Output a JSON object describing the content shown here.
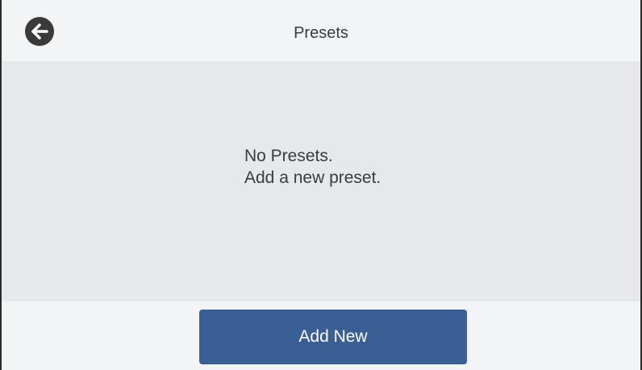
{
  "header": {
    "title": "Presets",
    "back_icon": "arrow-left-icon"
  },
  "content": {
    "message_line1": "No Presets.",
    "message_line2": "Add a new preset."
  },
  "footer": {
    "add_new_label": "Add New"
  },
  "colors": {
    "header_bg": "#f3f4f6",
    "content_bg": "#e6e8ea",
    "button_bg": "#3a5f95",
    "back_button_bg": "#3a3a3a"
  }
}
